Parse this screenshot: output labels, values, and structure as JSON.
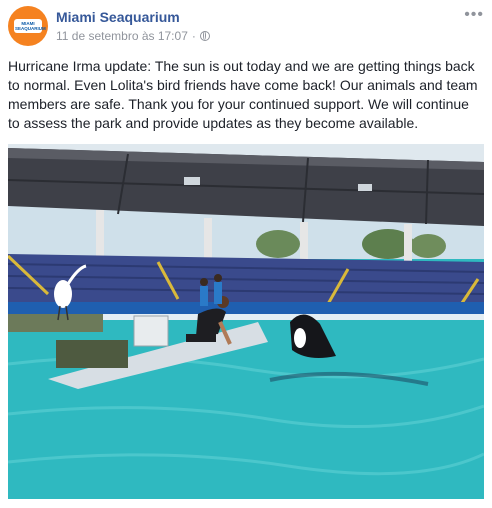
{
  "post": {
    "page_name": "Miami Seaquarium",
    "timestamp": "11 de setembro às 17:07",
    "separator": "·",
    "more_icon": "more-options-icon",
    "audience_icon": "globe-icon",
    "text": "Hurricane Irma update: The sun is out today and we are getting things back to normal. Even Lolita's bird friends have come back! Our animals and team members are safe. Thank you for your continued support. We will continue to assess the park and provide updates as they become available."
  },
  "avatar": {
    "logo_text": "MIAMI SEAQUARIUM",
    "color": "#f58220"
  },
  "colors": {
    "link": "#365899",
    "meta": "#90949c",
    "text": "#1d2129",
    "pool": "#2fb9c0"
  }
}
